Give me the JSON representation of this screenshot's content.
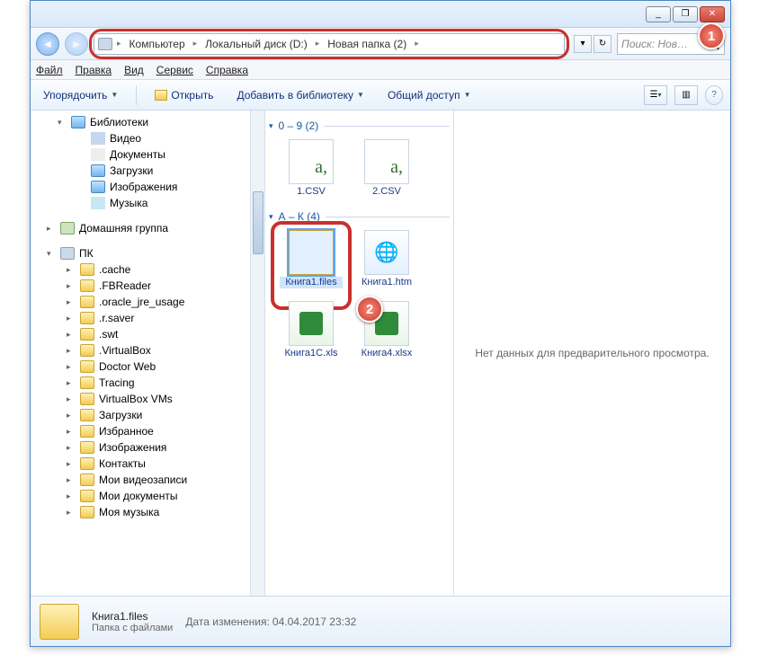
{
  "window": {
    "min": "_",
    "max": "❐",
    "close": "✕"
  },
  "breadcrumb": {
    "c0": "Компьютер",
    "c1": "Локальный диск (D:)",
    "c2": "Новая папка (2)"
  },
  "search": {
    "placeholder": "Поиск: Нов…"
  },
  "menu": {
    "file": "Файл",
    "edit": "Правка",
    "view": "Вид",
    "tools": "Сервис",
    "help": "Справка"
  },
  "toolbar": {
    "organize": "Упорядочить",
    "open": "Открыть",
    "addlib": "Добавить в библиотеку",
    "share": "Общий доступ"
  },
  "tree": {
    "libs": "Библиотеки",
    "video": "Видео",
    "docs": "Документы",
    "dl": "Загрузки",
    "img": "Изображения",
    "music": "Музыка",
    "homegroup": "Домашняя группа",
    "pc": "ПК",
    "f0": ".cache",
    "f1": ".FBReader",
    "f2": ".oracle_jre_usage",
    "f3": ".r.saver",
    "f4": ".swt",
    "f5": ".VirtualBox",
    "f6": "Doctor Web",
    "f7": "Tracing",
    "f8": "VirtualBox VMs",
    "f9": "Загрузки",
    "f10": "Избранное",
    "f11": "Изображения",
    "f12": "Контакты",
    "f13": "Мои видеозаписи",
    "f14": "Мои документы",
    "f15": "Моя музыка"
  },
  "groups": {
    "g1": {
      "header": "0 – 9 (2)",
      "items": [
        {
          "name": "1.CSV",
          "kind": "csv"
        },
        {
          "name": "2.CSV",
          "kind": "csv"
        }
      ]
    },
    "g2": {
      "header": "А – К (4)",
      "items": [
        {
          "name": "Книга1.files",
          "kind": "folder",
          "selected": true
        },
        {
          "name": "Книга1.htm",
          "kind": "htm"
        },
        {
          "name": "Книга1С.xls",
          "kind": "xls"
        },
        {
          "name": "Книга4.xlsx",
          "kind": "xls"
        }
      ]
    }
  },
  "preview": {
    "empty": "Нет данных для предварительного просмотра."
  },
  "status": {
    "name": "Книга1.files",
    "type": "Папка с файлами",
    "modlabel": "Дата изменения:",
    "modval": "04.04.2017 23:32"
  },
  "badges": {
    "b1": "1",
    "b2": "2"
  }
}
